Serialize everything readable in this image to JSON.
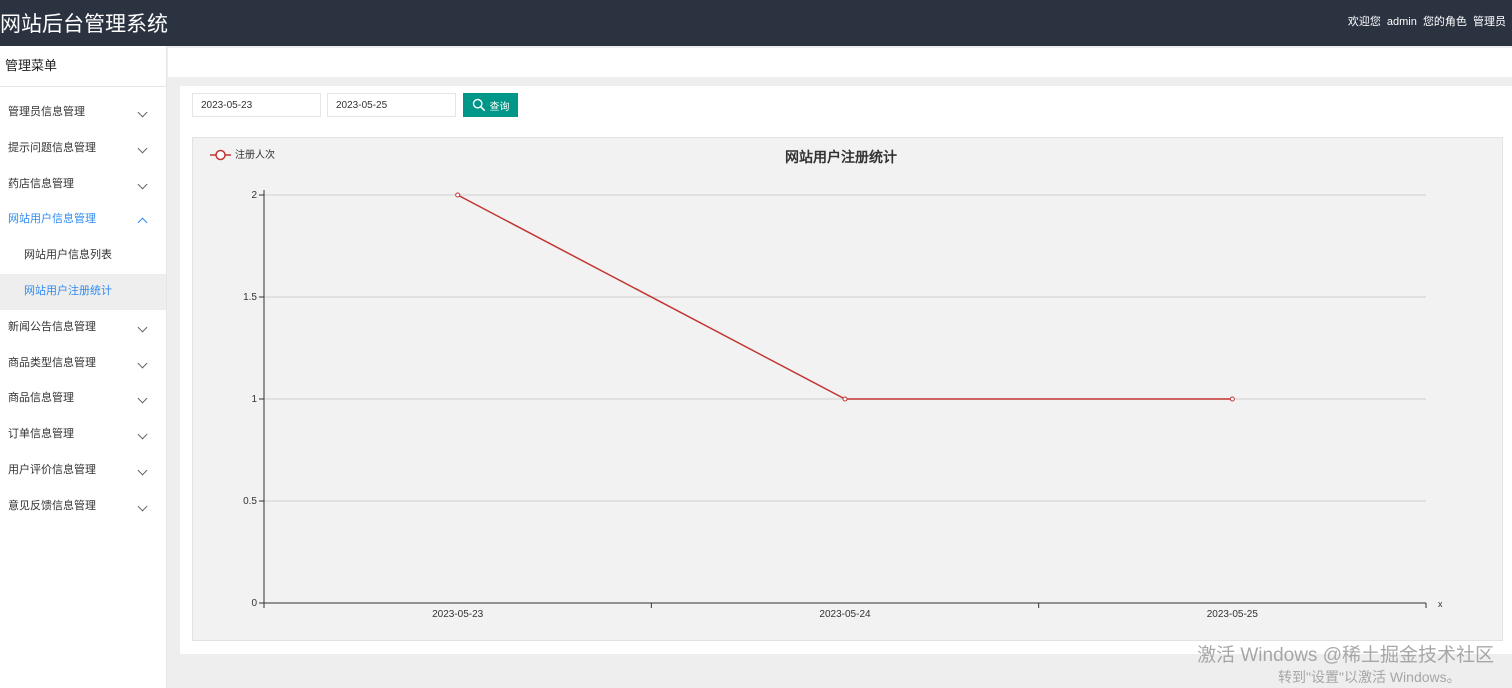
{
  "header": {
    "app_title": "网站后台管理系统",
    "welcome_label": "欢迎您",
    "username": "admin",
    "role_label": "您的角色",
    "role": "管理员"
  },
  "sidebar": {
    "title": "管理菜单",
    "items": [
      {
        "label": "管理员信息管理",
        "expanded": false
      },
      {
        "label": "提示问题信息管理",
        "expanded": false
      },
      {
        "label": "药店信息管理",
        "expanded": false
      },
      {
        "label": "网站用户信息管理",
        "expanded": true,
        "children": [
          {
            "label": "网站用户信息列表",
            "active": false
          },
          {
            "label": "网站用户注册统计",
            "active": true
          }
        ]
      },
      {
        "label": "新闻公告信息管理",
        "expanded": false
      },
      {
        "label": "商品类型信息管理",
        "expanded": false
      },
      {
        "label": "商品信息管理",
        "expanded": false
      },
      {
        "label": "订单信息管理",
        "expanded": false
      },
      {
        "label": "用户评价信息管理",
        "expanded": false
      },
      {
        "label": "意见反馈信息管理",
        "expanded": false
      }
    ]
  },
  "filter": {
    "start_date": "2023-05-23",
    "end_date": "2023-05-25",
    "search_label": "查询"
  },
  "colors": {
    "accent": "#2d8cf0",
    "button": "#009688",
    "series": "#c23531",
    "header_bg": "#2b3340"
  },
  "chart_data": {
    "type": "line",
    "title": "网站用户注册统计",
    "categories": [
      "2023-05-23",
      "2023-05-24",
      "2023-05-25"
    ],
    "series": [
      {
        "name": "注册人次",
        "values": [
          2,
          1,
          1
        ]
      }
    ],
    "xlabel": "x",
    "ylabel": "",
    "ylim": [
      0,
      2
    ],
    "yticks": [
      "0",
      "0.5",
      "1",
      "1.5",
      "2"
    ],
    "grid": true,
    "legend_position": "top-left"
  },
  "watermark": {
    "line1": "激活 Windows",
    "line1_overlay": "@稀土掘金技术社区",
    "line2": "转到\"设置\"以激活 Windows。"
  }
}
